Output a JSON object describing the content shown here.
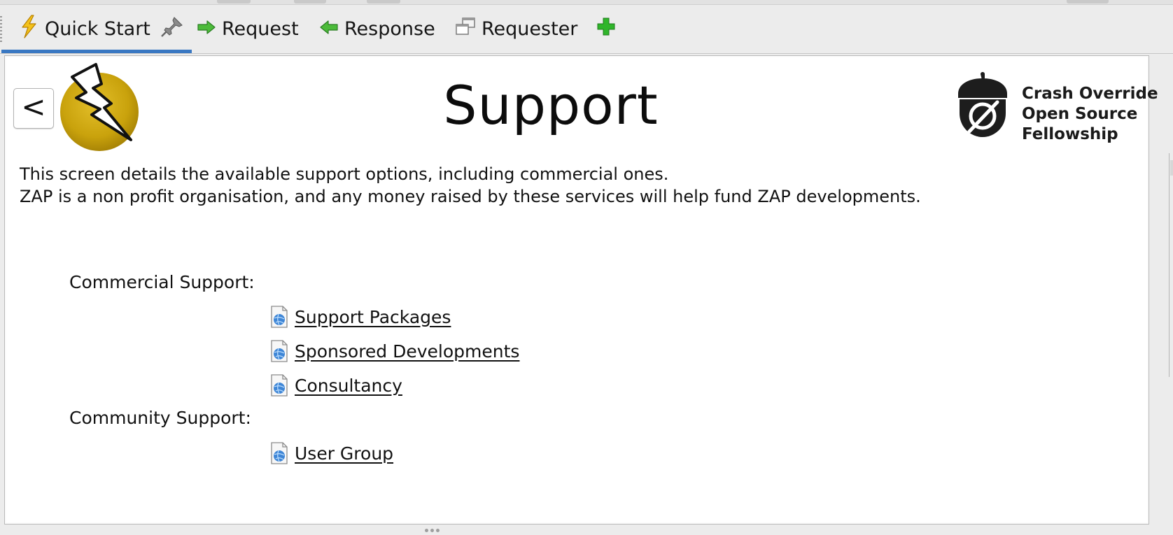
{
  "tabs": [
    {
      "label": "Quick Start",
      "icon": "lightning-icon",
      "active": true,
      "pinned": true
    },
    {
      "label": "Request",
      "icon": "arrow-right-icon"
    },
    {
      "label": "Response",
      "icon": "arrow-left-icon"
    },
    {
      "label": "Requester",
      "icon": "windows-icon"
    },
    {
      "label": "",
      "icon": "plus-icon"
    }
  ],
  "page": {
    "back_label": "<",
    "title": "Support",
    "sponsor": {
      "line1": "Crash Override",
      "line2": "Open Source",
      "line3": "Fellowship"
    },
    "description": [
      "This screen details the available support options, including commercial ones.",
      "ZAP is a non profit organisation, and any money raised by these services will help fund ZAP developments."
    ],
    "sections": [
      {
        "label": "Commercial Support:",
        "links": [
          "Support Packages",
          "Sponsored Developments",
          "Consultancy"
        ]
      },
      {
        "label": "Community Support:",
        "links": [
          "User Group"
        ]
      }
    ]
  },
  "colors": {
    "accent": "#3a78c2",
    "logo_gold": "#c9a20c",
    "arrow_green": "#3aa634"
  }
}
